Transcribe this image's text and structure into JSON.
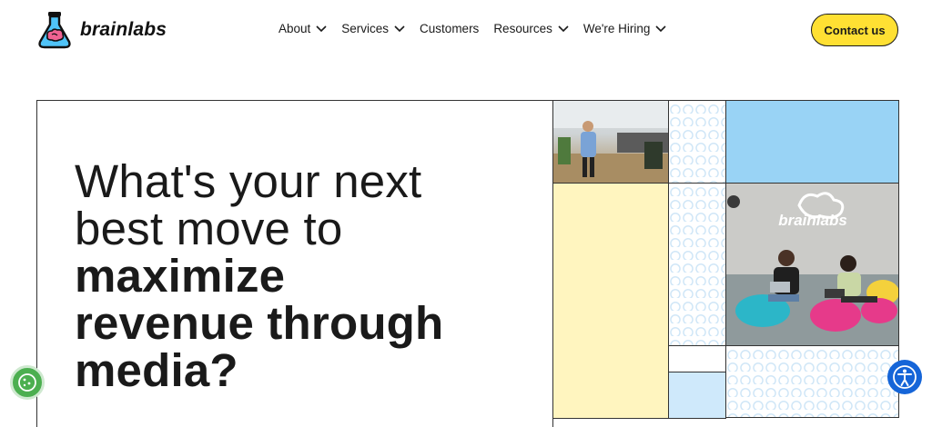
{
  "header": {
    "brand": "brainlabs",
    "nav": [
      {
        "label": "About",
        "has_dropdown": true
      },
      {
        "label": "Services",
        "has_dropdown": true
      },
      {
        "label": "Customers",
        "has_dropdown": false
      },
      {
        "label": "Resources",
        "has_dropdown": true
      },
      {
        "label": "We're Hiring",
        "has_dropdown": true
      }
    ],
    "cta": "Contact us"
  },
  "hero": {
    "line1": "What's your next",
    "line2": "best move to",
    "line3": "maximize",
    "line4": "revenue through",
    "line5": "media?"
  },
  "photo_sign": "brainlabs",
  "colors": {
    "accent_yellow": "#ffe033",
    "pale_yellow": "#fff5bf",
    "sky_blue": "#99d3f5",
    "light_blue": "#cfe9fb",
    "accessibility_blue": "#1565d8",
    "cookie_green": "#4caf50"
  },
  "icons": [
    "flask-brain-logo-icon",
    "chevron-down-icon",
    "cookie-icon",
    "accessibility-icon"
  ]
}
